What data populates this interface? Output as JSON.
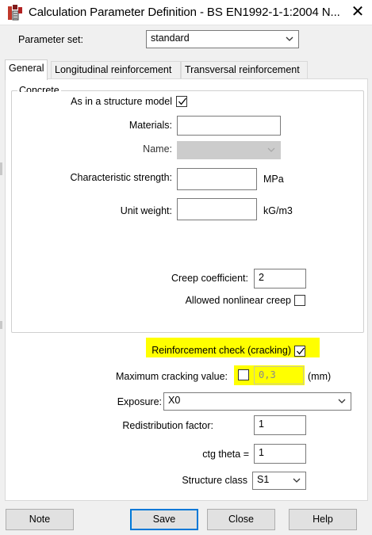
{
  "window": {
    "title": "Calculation Parameter Definition - BS EN1992-1-1:2004 N...",
    "close_glyph": "✕"
  },
  "parameter_set": {
    "label": "Parameter set:",
    "value": "standard"
  },
  "tabs": [
    {
      "label": "General",
      "active": true
    },
    {
      "label": "Longitudinal reinforcement",
      "active": false
    },
    {
      "label": "Transversal reinforcement",
      "active": false
    }
  ],
  "concrete": {
    "group_title": "Concrete",
    "as_in_model_label": "As in a structure model",
    "as_in_model_checked": true,
    "materials_label": "Materials:",
    "materials_value": "",
    "name_label": "Name:",
    "name_value": "",
    "char_strength_label": "Characteristic strength:",
    "char_strength_value": "",
    "char_strength_unit": "MPa",
    "unit_weight_label": "Unit weight:",
    "unit_weight_value": "",
    "unit_weight_unit": "kG/m3",
    "creep_label": "Creep coefficient:",
    "creep_value": "2",
    "nonlinear_label": "Allowed nonlinear creep",
    "nonlinear_checked": false
  },
  "reinforcement": {
    "check_label": "Reinforcement check (cracking)",
    "check_checked": true,
    "max_crack_label": "Maximum cracking value:",
    "max_crack_checked": false,
    "max_crack_value": "0,3",
    "max_crack_unit": "(mm)",
    "exposure_label": "Exposure:",
    "exposure_value": "X0",
    "redistribution_label": "Redistribution factor:",
    "redistribution_value": "1",
    "ctg_label": "ctg theta =",
    "ctg_value": "1",
    "structure_class_label": "Structure class",
    "structure_class_value": "S1"
  },
  "buttons": {
    "note": "Note",
    "save": "Save",
    "close": "Close",
    "help": "Help"
  },
  "colors": {
    "highlight": "#ffff00",
    "default_button_border": "#0078d7"
  }
}
